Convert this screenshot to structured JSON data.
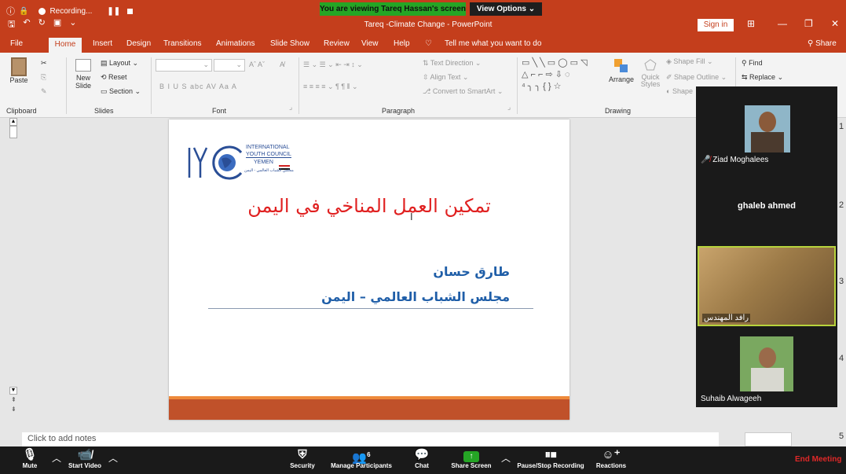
{
  "recording": {
    "label": "Recording...",
    "pause_icon": "pause-icon",
    "stop_icon": "stop-icon"
  },
  "share_banner": {
    "viewing": "You are viewing Tareq Hassan's screen",
    "view_options": "View Options ⌄"
  },
  "window": {
    "title": "Tareq -Climate Change - PowerPoint",
    "sign_in": "Sign in",
    "share": "Share"
  },
  "menu": {
    "tabs": [
      "File",
      "Home",
      "Insert",
      "Design",
      "Transitions",
      "Animations",
      "Slide Show",
      "Review",
      "View",
      "Help"
    ],
    "active": "Home",
    "tell_me": "Tell me what you want to do"
  },
  "ribbon": {
    "clipboard": {
      "paste": "Paste",
      "group": "Clipboard"
    },
    "slides": {
      "new_slide": "New Slide",
      "layout": "Layout",
      "reset": "Reset",
      "section": "Section",
      "group": "Slides"
    },
    "font": {
      "group": "Font",
      "format": "B  I  U  S  abc  AV  Aa  A"
    },
    "paragraph": {
      "text_direction": "Text Direction",
      "align_text": "Align Text",
      "convert": "Convert to SmartArt",
      "group": "Paragraph"
    },
    "drawing": {
      "arrange": "Arrange",
      "quick_styles": "Quick Styles",
      "shape_fill": "Shape Fill",
      "shape_outline": "Shape Outline",
      "shape_effects": "Shape",
      "group": "Drawing"
    },
    "editing": {
      "find": "Find",
      "replace": "Replace"
    }
  },
  "slide": {
    "logo_lines": [
      "INTERNATIONAL",
      "YOUTH COUNCIL",
      "YEMEN",
      "مجلس الشباب العالمي - اليمن"
    ],
    "title": "تمكين العمل المناخي في اليمن",
    "author": "طارق حسان",
    "org": "مجلس الشباب العالمي – اليمن"
  },
  "notes": {
    "placeholder": "Click to add notes"
  },
  "thumb_numbers": [
    "1",
    "2",
    "3",
    "4",
    "5"
  ],
  "participants": [
    {
      "name": "Ziad Moghalees",
      "muted": true
    },
    {
      "name": "ghaleb ahmed"
    },
    {
      "name": "رافد المهندس"
    },
    {
      "name": "Suhaib Alwageeh"
    }
  ],
  "zoom_toolbar": {
    "mute": "Mute",
    "start_video": "Start Video",
    "security": "Security",
    "manage_participants": "Manage Participants",
    "participant_count": "6",
    "chat": "Chat",
    "share_screen": "Share Screen",
    "recording": "Pause/Stop Recording",
    "reactions": "Reactions",
    "end_meeting": "End Meeting"
  },
  "colors": {
    "ppt_red": "#c43e1c",
    "title_red": "#e02020",
    "author_blue": "#1f5ea8",
    "zoom_bg": "#1a1a1a",
    "active_speaker": "#b7d33c"
  }
}
